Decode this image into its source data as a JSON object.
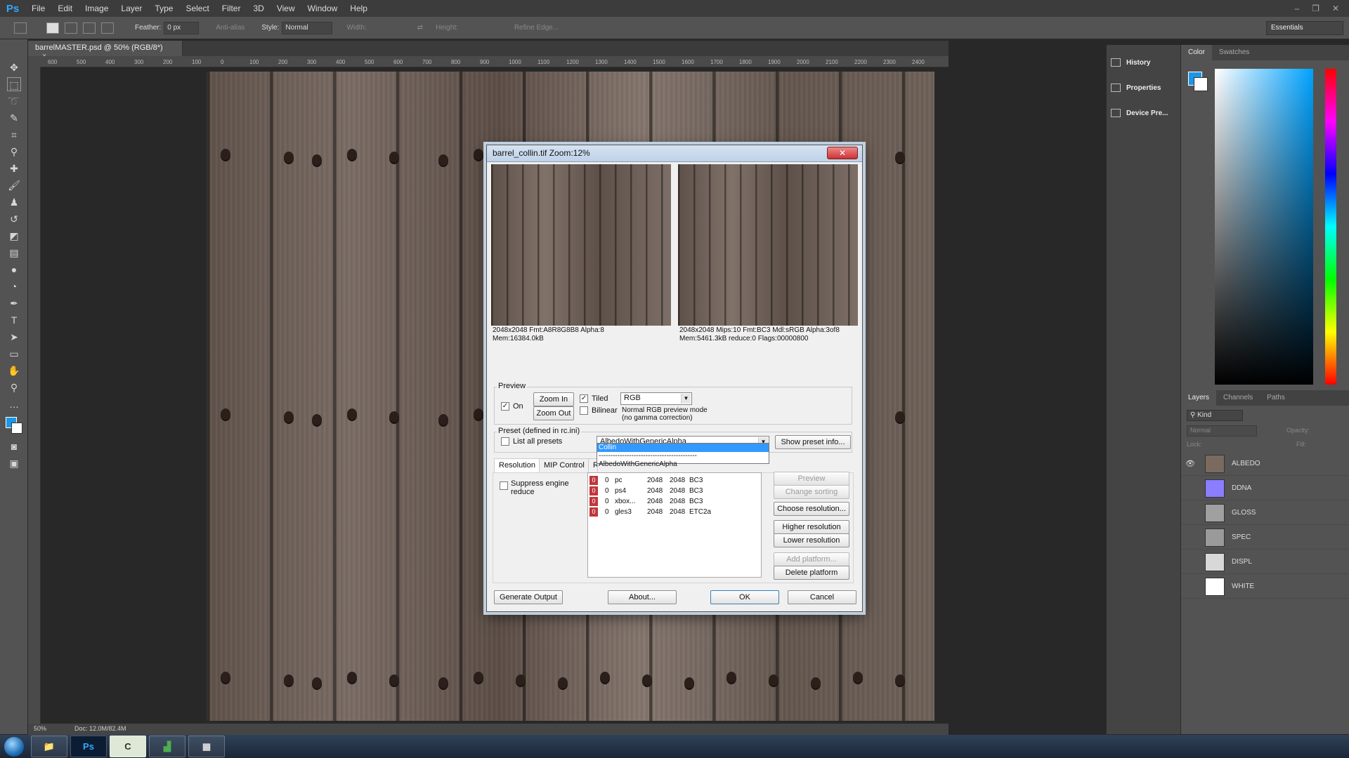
{
  "app": {
    "logo": "Ps",
    "menu": [
      "File",
      "Edit",
      "Image",
      "Layer",
      "Type",
      "Select",
      "Filter",
      "3D",
      "View",
      "Window",
      "Help"
    ],
    "window_controls": [
      "–",
      "❐",
      "✕"
    ]
  },
  "options_bar": {
    "feather_label": "Feather:",
    "feather_value": "0 px",
    "antialias": "Anti-alias",
    "style_label": "Style:",
    "style_value": "Normal",
    "width_label": "Width:",
    "height_label": "Height:",
    "refine_edge": "Refine Edge...",
    "workspace": "Essentials"
  },
  "document": {
    "tab_title": "barrelMASTER.psd @ 50% (RGB/8*)",
    "tab_close": "×",
    "ruler_marks": [
      "600",
      "500",
      "400",
      "300",
      "200",
      "100",
      "0",
      "100",
      "200",
      "300",
      "400",
      "500",
      "600",
      "700",
      "800",
      "900",
      "1000",
      "1100",
      "1200",
      "1300",
      "1400",
      "1500",
      "1600",
      "1700",
      "1800",
      "1900",
      "2000",
      "2100",
      "2200",
      "2300",
      "2400"
    ],
    "zoom": "50%",
    "doc_size": "Doc: 12.0M/82.4M"
  },
  "panels": {
    "collapsed": [
      {
        "label": "History",
        "icon": "history-icon"
      },
      {
        "label": "Properties",
        "icon": "properties-icon"
      },
      {
        "label": "Device Pre...",
        "icon": "device-preview-icon"
      }
    ],
    "color_tabs": [
      "Color",
      "Swatches"
    ],
    "layers_tabs": [
      "Layers",
      "Channels",
      "Paths"
    ],
    "layers_filter": "Kind",
    "blend_mode": "Normal",
    "opacity_label": "Opacity:",
    "lock_label": "Lock:",
    "fill_label": "Fill:",
    "layers": [
      {
        "name": "ALBEDO",
        "visible": true,
        "thumb": "#7a6a60"
      },
      {
        "name": "DDNA",
        "visible": false,
        "thumb": "#8b7dff"
      },
      {
        "name": "GLOSS",
        "visible": false,
        "thumb": "#a0a0a0"
      },
      {
        "name": "SPEC",
        "visible": false,
        "thumb": "#9a9a9a"
      },
      {
        "name": "DISPL",
        "visible": false,
        "thumb": "#d8d8d8"
      },
      {
        "name": "WHITE",
        "visible": false,
        "thumb": "#ffffff"
      }
    ],
    "fg_color": "#1e96e6",
    "bg_color": "#ffffff"
  },
  "dialog": {
    "title": "barrel_collin.tif  Zoom:12%",
    "close": "✕",
    "left_info": "2048x2048 Fmt:A8R8G8B8 Alpha:8\nMem:16384.0kB",
    "right_info": "2048x2048 Mips:10 Fmt:BC3 Mdl:sRGB Alpha:3of8\nMem:5461.3kB reduce:0 Flags:00000800",
    "preview": {
      "group_label": "Preview",
      "on_label": "On",
      "on_checked": true,
      "zoom_in": "Zoom In",
      "zoom_out": "Zoom Out",
      "tiled_label": "Tiled",
      "tiled_checked": true,
      "bilinear_label": "Bilinear",
      "bilinear_checked": false,
      "channel": "RGB",
      "mode_note": "Normal RGB preview mode\n(no gamma correction)"
    },
    "preset": {
      "group_label": "Preset (defined in rc.ini)",
      "list_all_label": "List all presets",
      "list_all_checked": false,
      "selected": "AlbedoWithGenericAlpha",
      "show_info": "Show preset info...",
      "dropdown_items": [
        "Collin",
        "------------------------------------------",
        "AlbedoWithGenericAlpha"
      ],
      "dropdown_selected": 0
    },
    "tabs": [
      "Resolution",
      "MIP Control",
      "R"
    ],
    "suppress_label": "Suppress engine reduce",
    "platforms": [
      {
        "flag": "0",
        "reduce": "0",
        "name": "pc",
        "w": "2048",
        "h": "2048",
        "fmt": "BC3"
      },
      {
        "flag": "0",
        "reduce": "0",
        "name": "ps4",
        "w": "2048",
        "h": "2048",
        "fmt": "BC3"
      },
      {
        "flag": "0",
        "reduce": "0",
        "name": "xbox...",
        "w": "2048",
        "h": "2048",
        "fmt": "BC3"
      },
      {
        "flag": "0",
        "reduce": "0",
        "name": "gles3",
        "w": "2048",
        "h": "2048",
        "fmt": "ETC2a"
      }
    ],
    "side_buttons": {
      "preview": "Preview",
      "change_sorting": "Change sorting",
      "choose_resolution": "Choose resolution...",
      "higher": "Higher resolution",
      "lower": "Lower resolution",
      "add_platform": "Add platform...",
      "delete_platform": "Delete platform"
    },
    "bottom_buttons": {
      "generate": "Generate Output",
      "about": "About...",
      "ok": "OK",
      "cancel": "Cancel"
    }
  },
  "taskbar": {
    "apps": [
      {
        "name": "explorer",
        "label": "📁"
      },
      {
        "name": "photoshop",
        "label": "Ps"
      },
      {
        "name": "cryengine",
        "label": "C"
      },
      {
        "name": "chart-app",
        "label": "▟"
      },
      {
        "name": "calculator",
        "label": "▦"
      }
    ]
  }
}
